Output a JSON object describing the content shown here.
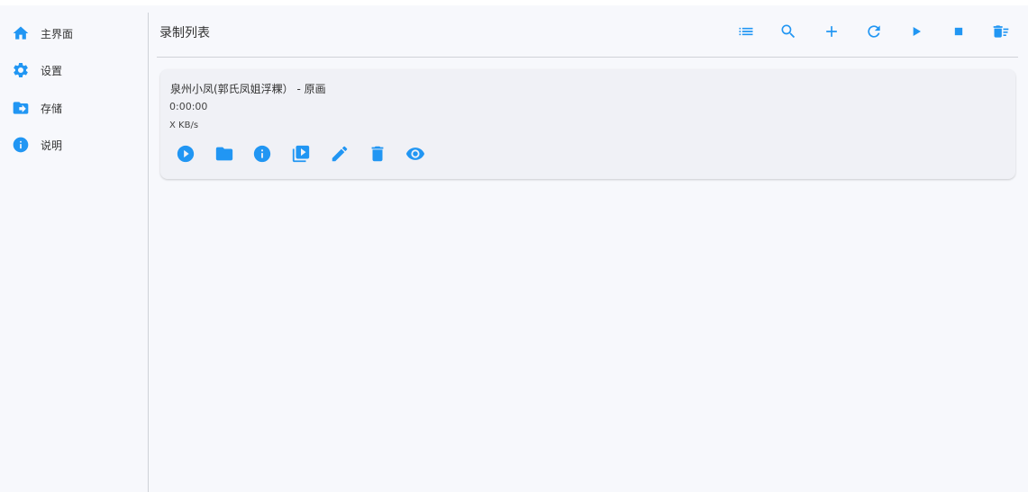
{
  "colors": {
    "accent": "#2196f3",
    "background": "#f7f8fc",
    "card": "#f0f1f6"
  },
  "sidebar": {
    "items": [
      {
        "label": "主界面",
        "icon": "home-icon"
      },
      {
        "label": "设置",
        "icon": "gear-icon"
      },
      {
        "label": "存储",
        "icon": "folder-arrow-icon"
      },
      {
        "label": "说明",
        "icon": "info-icon"
      }
    ]
  },
  "header": {
    "title": "录制列表",
    "toolbar": [
      "list-icon",
      "search-icon",
      "add-icon",
      "refresh-icon",
      "play-icon",
      "stop-icon",
      "delete-sweep-icon"
    ]
  },
  "recordings": [
    {
      "title": "泉州小凤(郭氏凤姐浮粿）  - 原画",
      "duration": "0:00:00",
      "speed": "X KB/s",
      "actions": [
        "play-circle-icon",
        "folder-icon",
        "info-icon",
        "video-library-icon",
        "edit-icon",
        "delete-icon",
        "eye-icon"
      ]
    }
  ]
}
